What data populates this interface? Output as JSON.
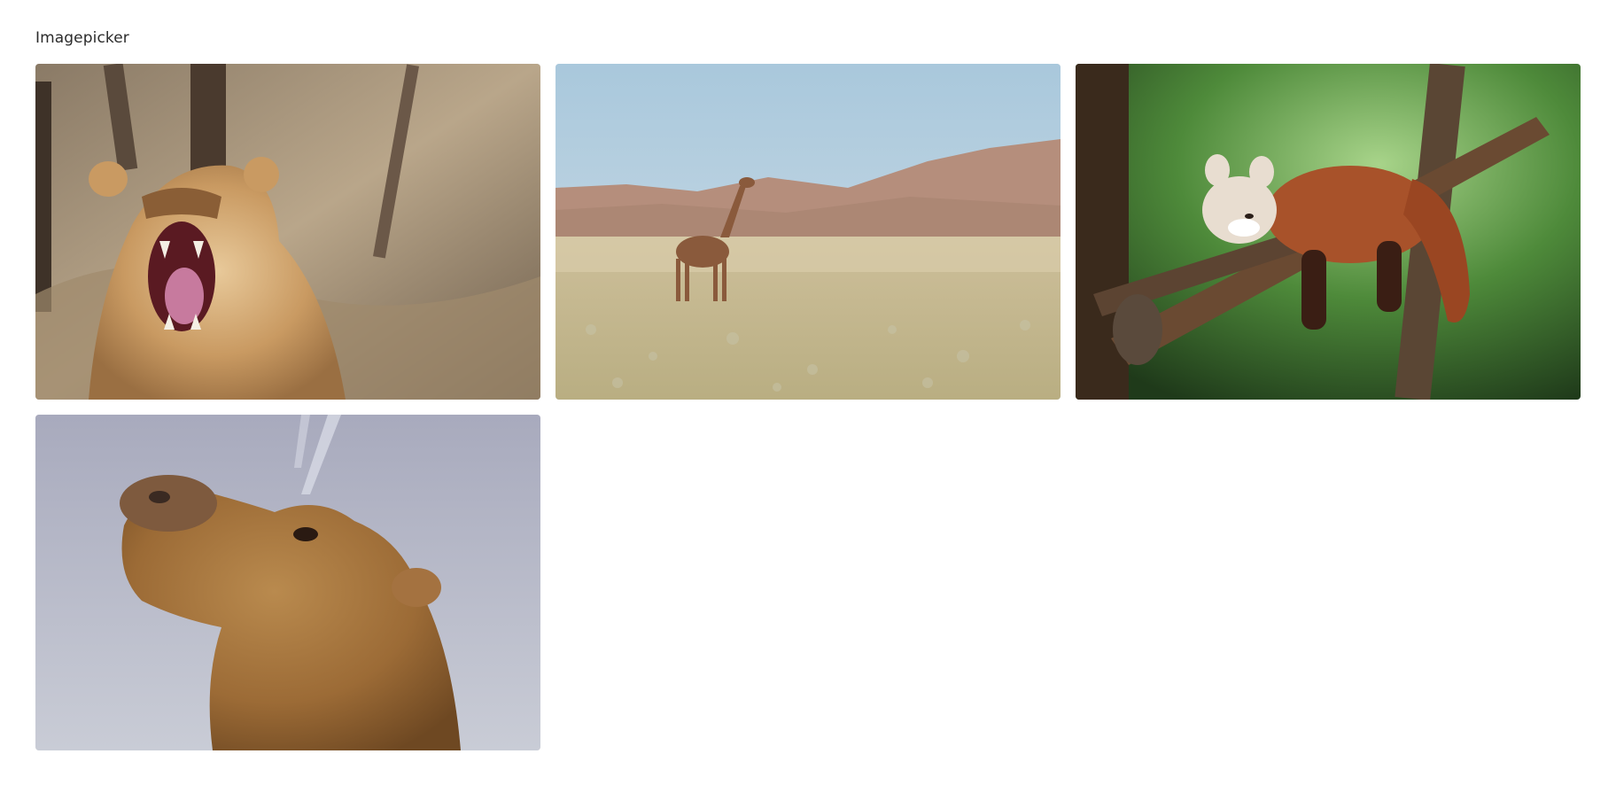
{
  "imagepicker": {
    "title": "Imagepicker",
    "images": [
      {
        "subject": "lioness-yawning",
        "icon": "lioness-image"
      },
      {
        "subject": "giraffe-in-savanna",
        "icon": "giraffe-image"
      },
      {
        "subject": "red-panda-sleeping-on-branch",
        "icon": "red-panda-image"
      },
      {
        "subject": "camel-head-against-sky",
        "icon": "camel-image"
      }
    ]
  }
}
